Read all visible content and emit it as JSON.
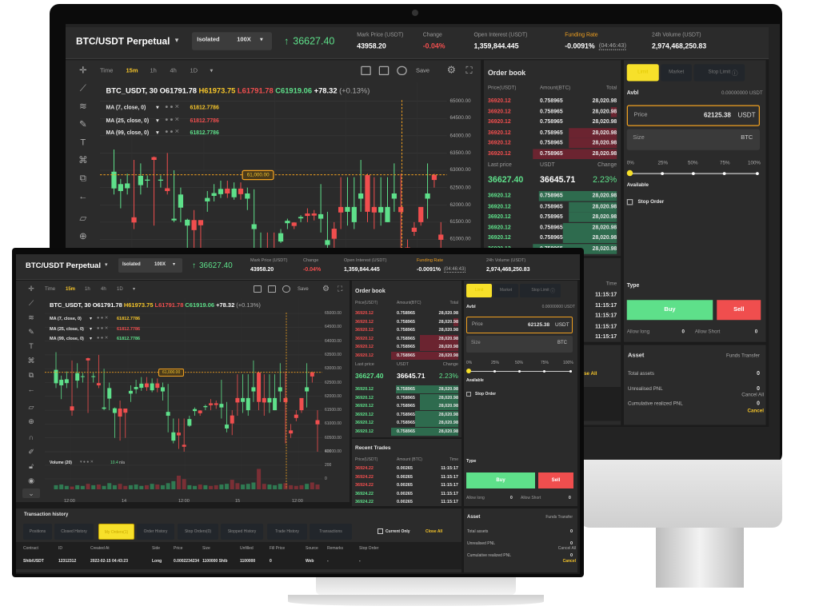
{
  "header": {
    "pair": "BTC/USDT Perpetual",
    "margin_mode": "Isolated",
    "leverage": "100X",
    "last_price": "36627.40",
    "stats": [
      {
        "label": "Mark Price (USDT)",
        "value": "43958.20"
      },
      {
        "label": "Change",
        "value": "-0.04%"
      },
      {
        "label": "Open Interest (USDT)",
        "value": "1,359,844.445"
      },
      {
        "label": "Funding Rate",
        "value": "-0.0091%",
        "extra": "(04:46:43)"
      },
      {
        "label": "24h Volume (USDT)",
        "value": "2,974,468,250.83"
      }
    ]
  },
  "chart": {
    "intervals": [
      "Time",
      "15m",
      "1h",
      "4h",
      "1D"
    ],
    "active_interval": "15m",
    "save_label": "Save",
    "ohlc_line": {
      "symbol": "BTC_USDT, 30",
      "o": "O61791.78",
      "h": "H61973.75",
      "l": "L61791.78",
      "c": "C61919.06",
      "chg": "+78.32",
      "pct": "(+0.13%)"
    },
    "indicators": [
      {
        "label": "MA (7, close, 0)",
        "value": "61812.7786",
        "color": "#f7c62a"
      },
      {
        "label": "MA (25, close, 0)",
        "value": "61812.7786",
        "color": "#f04e4e"
      },
      {
        "label": "MA (99, close, 0)",
        "value": "61812.7786",
        "color": "#5ee08a"
      }
    ],
    "volume_label": "Volume (20)",
    "volume_value": "10.4",
    "volume_na": "n/a",
    "crosshair_price": "61,000.00",
    "price_ticks": [
      "65000.00",
      "64500.00",
      "64000.00",
      "63500.00",
      "63000.00",
      "62500.00",
      "62000.00",
      "61500.00",
      "61000.00",
      "60500.00",
      "60000.00"
    ],
    "volume_ticks": [
      "400",
      "200",
      "0"
    ],
    "time_ticks": [
      "12:00",
      "14",
      "12:00",
      "15",
      "12:00"
    ]
  },
  "chart_data": {
    "type": "candlestick",
    "ylim": [
      60000,
      65000
    ],
    "columns": [
      "open",
      "close",
      "high",
      "low"
    ],
    "candles": [
      [
        62475,
        62960,
        63600,
        62300
      ],
      [
        62400,
        62600,
        62750,
        61900
      ],
      [
        62480,
        62620,
        62900,
        62300
      ],
      [
        61640,
        61490,
        63300,
        61300
      ],
      [
        62570,
        62840,
        63200,
        62300
      ],
      [
        62700,
        62730,
        62850,
        62500
      ],
      [
        63380,
        63300,
        63400,
        61400
      ],
      [
        62700,
        62730,
        62850,
        62500
      ],
      [
        62480,
        62400,
        63500,
        62300
      ],
      [
        61550,
        61600,
        63000,
        61500
      ],
      [
        61920,
        62300,
        62500,
        61500
      ],
      [
        61400,
        61570,
        61600,
        60500
      ],
      [
        61560,
        61270,
        61850,
        60400
      ],
      [
        61560,
        61410,
        61550,
        60500
      ],
      [
        62100,
        62200,
        62400,
        61800
      ],
      [
        62260,
        62340,
        62600,
        62100
      ],
      [
        62310,
        62460,
        62700,
        62200
      ],
      [
        62470,
        62330,
        62700,
        62200
      ],
      [
        62220,
        62470,
        62650,
        62150
      ],
      [
        62470,
        62310,
        62650,
        62150
      ],
      [
        62180,
        62330,
        62500,
        61850
      ],
      [
        61300,
        61440,
        62450,
        60700
      ],
      [
        60400,
        60700,
        61200,
        60300
      ],
      [
        60690,
        60590,
        61200,
        60100
      ],
      [
        60250,
        60180,
        61200,
        60000
      ],
      [
        60940,
        61180,
        61300,
        60900
      ],
      [
        61470,
        61540,
        61600,
        61300
      ],
      [
        61490,
        61390,
        61500,
        61300
      ],
      [
        61610,
        61650,
        61700,
        61500
      ],
      [
        61750,
        61680,
        61900,
        61500
      ],
      [
        61750,
        61690,
        61850,
        61550
      ],
      [
        61600,
        61730,
        62600,
        61200
      ],
      [
        60840,
        60980,
        61800,
        60700
      ],
      [
        61310,
        61020,
        61500,
        60600
      ],
      [
        61940,
        61780,
        62800,
        61300
      ],
      [
        61800,
        61940,
        62800,
        61400
      ],
      [
        61500,
        61940,
        62800,
        61300
      ],
      [
        62180,
        62330,
        63300,
        61800
      ],
      [
        62860,
        61800,
        62900,
        61500
      ],
      [
        61940,
        61780,
        62800,
        61300
      ],
      [
        61780,
        61940,
        62800,
        61400
      ],
      [
        61500,
        61940,
        62800,
        61500
      ],
      [
        62180,
        62330,
        63200,
        61800
      ],
      [
        61940,
        61790,
        62900,
        60300
      ],
      [
        60770,
        60660,
        61000,
        60500
      ],
      [
        61340,
        61220,
        61500,
        61100
      ],
      [
        61940,
        61500,
        61600,
        61400
      ],
      [
        62180,
        62330,
        63200,
        61600
      ],
      [
        62870,
        62720,
        62900,
        62500
      ],
      [
        61140,
        60990,
        61500,
        60000
      ]
    ],
    "volume": [
      60,
      70,
      50,
      40,
      60,
      50,
      80,
      60,
      70,
      50,
      90,
      60,
      80,
      50,
      60,
      70,
      50,
      60,
      80,
      70,
      60,
      90,
      120,
      200,
      150,
      60,
      50,
      70,
      60,
      50,
      60,
      70,
      80,
      140,
      90,
      70,
      80,
      100,
      300,
      80,
      70,
      60,
      80,
      90,
      60,
      50,
      60,
      80,
      100,
      70
    ]
  },
  "orderbook": {
    "title": "Order book",
    "headers": [
      "Price(USDT)",
      "Amount(BTC)",
      "Total"
    ],
    "asks": [
      [
        "36920.12",
        "0.758965",
        "28,020.98"
      ],
      [
        "36920.12",
        "0.758965",
        "28,020.98"
      ],
      [
        "36920.12",
        "0.758965",
        "28,020.98"
      ],
      [
        "36920.12",
        "0.758965",
        "28,020.98"
      ],
      [
        "36920.12",
        "0.758965",
        "28,020.98"
      ],
      [
        "36920.12",
        "0.758965",
        "28,020.98"
      ]
    ],
    "ask_depth": [
      0,
      0.05,
      0,
      0.4,
      0.4,
      0.7
    ],
    "mid_headers": [
      "Last price",
      "USDT",
      "Change"
    ],
    "mid_values": [
      "36627.40",
      "36645.71",
      "2.23%"
    ],
    "bids": [
      [
        "36920.12",
        "0.758965",
        "28,020.98"
      ],
      [
        "36920.12",
        "0.758965",
        "28,020.98"
      ],
      [
        "36920.12",
        "0.758965",
        "28,020.98"
      ],
      [
        "36920.12",
        "0.758965",
        "28,020.98"
      ],
      [
        "36920.12",
        "0.758965",
        "28,020.98"
      ],
      [
        "36920.12",
        "0.758965",
        "28,020.98"
      ]
    ],
    "bid_depth": [
      0.65,
      0.4,
      0.4,
      0.45,
      0.45,
      0.7
    ]
  },
  "trades": {
    "title": "Recent Trades",
    "headers": [
      "Price(USDT)",
      "Amount (BTC)",
      "Time"
    ],
    "rows": [
      [
        "36924.22",
        "0.00265",
        "11:15:17",
        "sell"
      ],
      [
        "36924.22",
        "0.00265",
        "11:15:17",
        "sell"
      ],
      [
        "36924.22",
        "0.00265",
        "11:15:17",
        "sell"
      ],
      [
        "36924.22",
        "0.00265",
        "11:15:17",
        "buy"
      ],
      [
        "36924.22",
        "0.00265",
        "11:15:17",
        "buy"
      ]
    ]
  },
  "trade_panel": {
    "tabs": [
      "Limit",
      "Market",
      "Stop Limit"
    ],
    "avbl_label": "Avbl",
    "avbl_value": "0.00000000 USDT",
    "price_label": "Price",
    "price_value": "62125.38",
    "price_unit": "USDT",
    "size_label": "Size",
    "size_unit": "BTC",
    "percents": [
      "0%",
      "25%",
      "50%",
      "75%",
      "100%"
    ],
    "slider_value": 0,
    "available_label": "Available",
    "stop_order_label": "Stop Order",
    "type_label": "Type",
    "buy": "Buy",
    "sell": "Sell",
    "allow_long_label": "Allow long",
    "allow_long": "0",
    "allow_short_label": "Allow Short",
    "allow_short": "0"
  },
  "asset": {
    "title": "Asset",
    "transfer": "Funds Transfer",
    "rows": [
      [
        "Total assets",
        "0"
      ],
      [
        "Unrealised PNL",
        "0"
      ],
      [
        "Cumulative realized PNL",
        "0"
      ]
    ]
  },
  "history": {
    "title": "Transaction history",
    "tabs": [
      "Positions",
      "Closed History",
      "My Orders(1)",
      "Order History",
      "Stop Orders(0)",
      "Stopped History",
      "Trade History",
      "Transactions"
    ],
    "active_tab": 2,
    "current_only": "Current Only",
    "close_all": "Close All",
    "columns": [
      "Contract",
      "ID",
      "Created At",
      "Side",
      "Price",
      "Size",
      "Unfilled",
      "Fill Price",
      "Source",
      "Remarks",
      "Stop Order",
      "Cancel All"
    ],
    "rows": [
      [
        "Shib/USDT",
        "12312312",
        "2022-02-15 04:43:23",
        "Long",
        "0.0002234234",
        "1100000 Shib",
        "1100000",
        "0",
        "Web",
        "-",
        "-",
        "Cancel"
      ]
    ]
  },
  "colors": {
    "green": "#5ee08a",
    "red": "#f04e4e",
    "accent": "#f7e02a",
    "funding": "#f0a020",
    "bg": "#2b2b2b"
  }
}
